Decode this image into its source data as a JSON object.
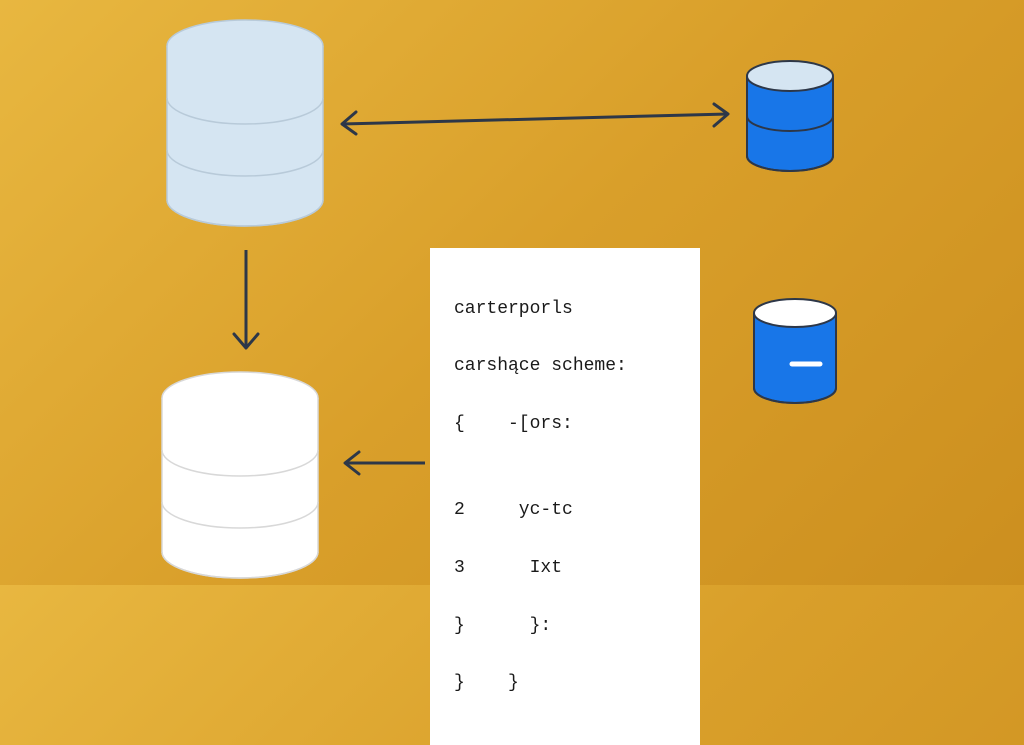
{
  "code": {
    "line1": "carterporls",
    "line2": "carshące scheme:",
    "line3": "{    -[ors:",
    "line4": "",
    "line5": "2     yc-tc",
    "line6": "3      Ixt",
    "line7": "}      }:",
    "line8": "}    }"
  },
  "cylinders": {
    "large_light": {
      "fill": "#d5e5f2",
      "stroke": "#b8cad9"
    },
    "large_white": {
      "fill": "#ffffff",
      "stroke": "#d8d8d8"
    },
    "small_blue_top": {
      "top_fill": "#d5e5f2",
      "body_fill": "#1876e8",
      "stroke": "#2d3748"
    },
    "small_blue_bottom": {
      "top_fill": "#ffffff",
      "body_fill": "#1876e8",
      "stroke": "#2d3748"
    }
  },
  "arrows": {
    "stroke": "#2d3748"
  }
}
